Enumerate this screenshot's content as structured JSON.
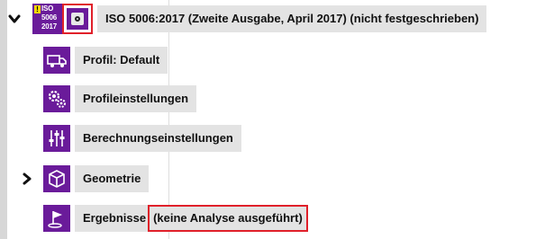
{
  "tree": {
    "root": {
      "badge_warn": "!",
      "badge_lines": [
        "ISO",
        "5006",
        "2017"
      ],
      "label": "ISO 5006:2017 (Zweite Ausgabe, April 2017) (nicht festgeschrieben)",
      "expanded": true
    },
    "items": [
      {
        "label": "Profil: Default",
        "icon": "truck-icon"
      },
      {
        "label": "Profileinstellungen",
        "icon": "gears-icon"
      },
      {
        "label": "Berechnungseinstellungen",
        "icon": "sliders-icon"
      },
      {
        "label": "Geometrie",
        "icon": "cube-icon",
        "collapsed": true
      },
      {
        "label": "Ergebnisse",
        "status": "(keine Analyse ausgeführt)",
        "icon": "flag-icon"
      }
    ]
  },
  "colors": {
    "icon_bg": "#6a1b9a",
    "label_bg": "#e3e3e3",
    "highlight_border": "#e0202a",
    "warning": "#f4d600"
  }
}
